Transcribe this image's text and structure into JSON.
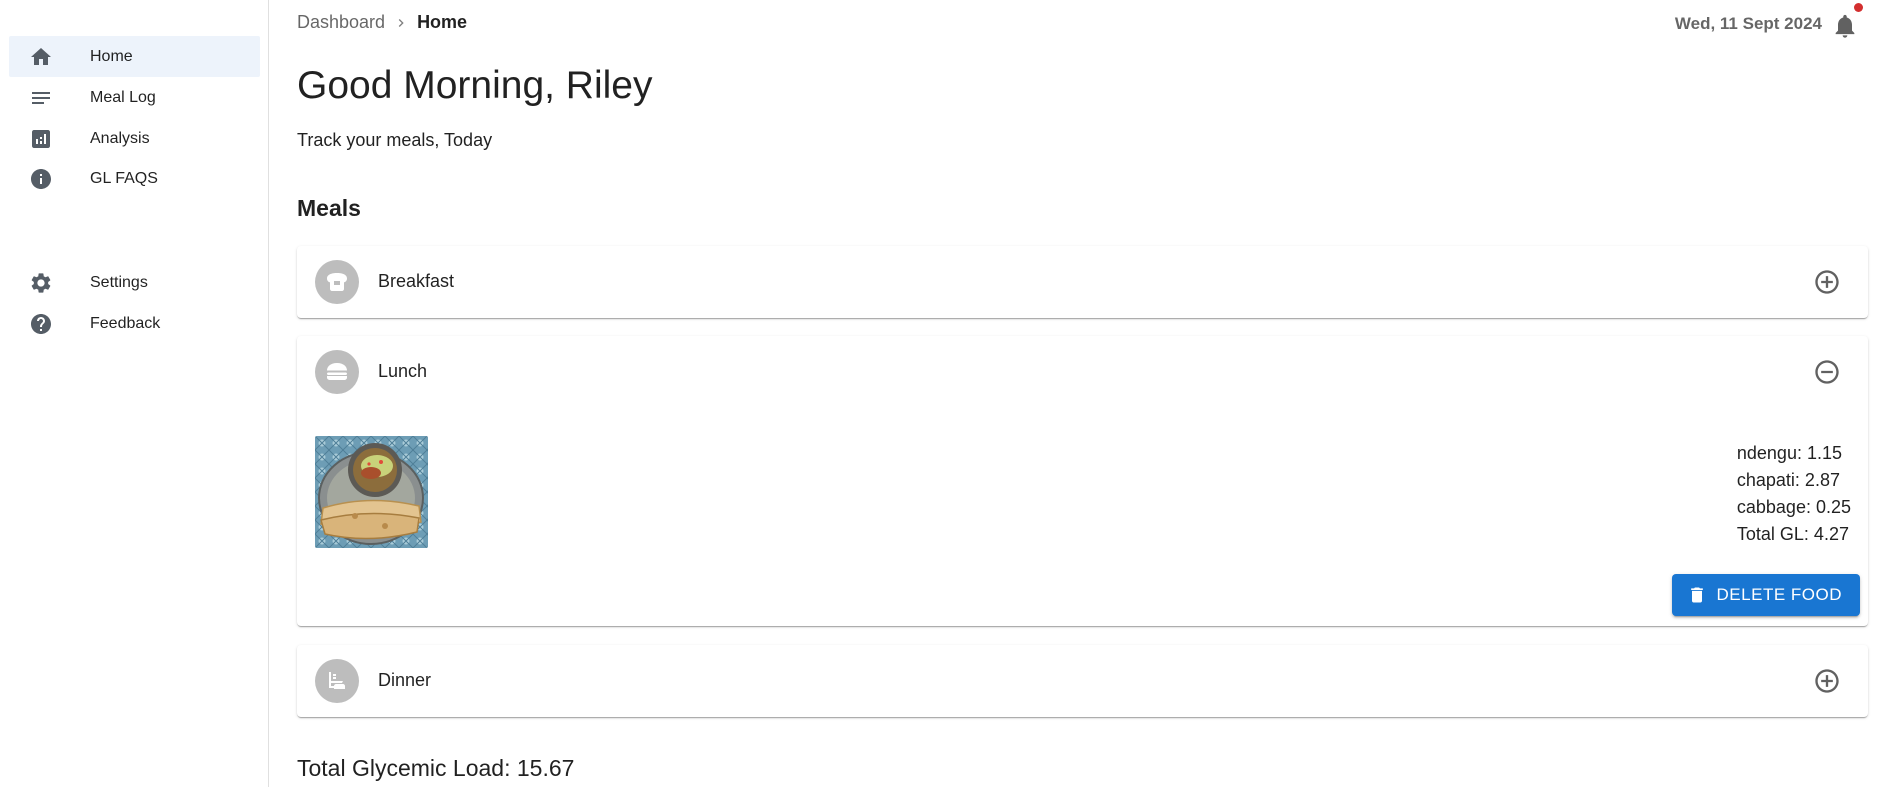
{
  "sidebar": {
    "items": [
      {
        "label": "Home",
        "icon": "home-icon"
      },
      {
        "label": "Meal Log",
        "icon": "notes-icon"
      },
      {
        "label": "Analysis",
        "icon": "analytics-icon"
      },
      {
        "label": "GL FAQS",
        "icon": "info-icon"
      },
      {
        "label": "Settings",
        "icon": "gear-icon"
      },
      {
        "label": "Feedback",
        "icon": "help-icon"
      }
    ]
  },
  "header": {
    "breadcrumb": {
      "parent": "Dashboard",
      "current": "Home"
    },
    "date": "Wed, 11 Sept 2024"
  },
  "main": {
    "greeting": "Good Morning, Riley",
    "subtitle": "Track your meals, Today",
    "meals_heading": "Meals",
    "meals": [
      {
        "name": "Breakfast",
        "icon": "breakfast-icon",
        "expanded": false
      },
      {
        "name": "Lunch",
        "icon": "lunch-icon",
        "expanded": true,
        "foods": [
          {
            "label": "ndengu: 1.15"
          },
          {
            "label": "chapati: 2.87"
          },
          {
            "label": "cabbage: 0.25"
          },
          {
            "label": "Total GL: 4.27"
          }
        ],
        "delete_label": "DELETE FOOD"
      },
      {
        "name": "Dinner",
        "icon": "dinner-icon",
        "expanded": false
      }
    ],
    "total_gl": "Total Glycemic Load: 15.67"
  },
  "colors": {
    "accent": "#1976d2",
    "active_nav_bg": "#edf3fb",
    "notification_dot": "#d32f2f",
    "avatar_bg": "#bdbdbd"
  }
}
